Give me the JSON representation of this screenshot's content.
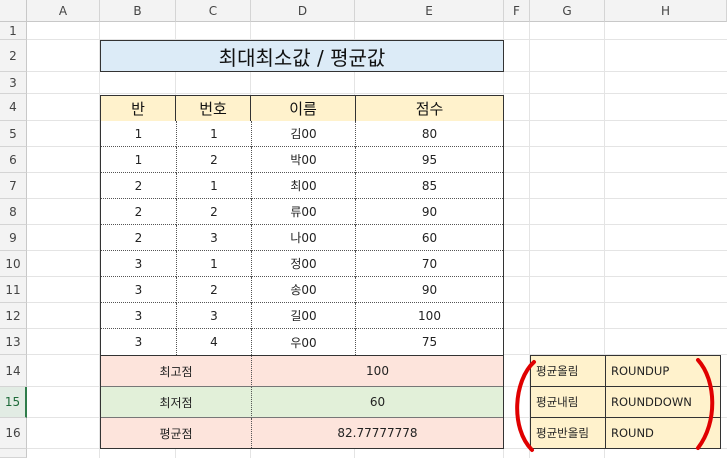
{
  "columns": [
    "A",
    "B",
    "C",
    "D",
    "E",
    "F",
    "G",
    "H"
  ],
  "rows": [
    "1",
    "2",
    "3",
    "4",
    "5",
    "6",
    "7",
    "8",
    "9",
    "10",
    "11",
    "12",
    "13",
    "14",
    "15",
    "16"
  ],
  "title": "최대최소값 / 평균값",
  "table": {
    "headers": [
      "반",
      "번호",
      "이름",
      "점수"
    ],
    "rows": [
      [
        "1",
        "1",
        "김00",
        "80"
      ],
      [
        "1",
        "2",
        "박00",
        "95"
      ],
      [
        "2",
        "1",
        "최00",
        "85"
      ],
      [
        "2",
        "2",
        "류00",
        "90"
      ],
      [
        "2",
        "3",
        "나00",
        "60"
      ],
      [
        "3",
        "1",
        "정00",
        "70"
      ],
      [
        "3",
        "2",
        "송00",
        "90"
      ],
      [
        "3",
        "3",
        "길00",
        "100"
      ],
      [
        "3",
        "4",
        "우00",
        "75"
      ]
    ]
  },
  "summary": [
    {
      "label": "최고점",
      "value": "100",
      "color": "#fde4dc"
    },
    {
      "label": "최저점",
      "value": "60",
      "color": "#e2f0d9"
    },
    {
      "label": "평균점",
      "value": "82.77777778",
      "color": "#fde4dc"
    }
  ],
  "functions": [
    {
      "label": "평균올림",
      "fn": "ROUNDUP"
    },
    {
      "label": "평균내림",
      "fn": "ROUNDDOWN"
    },
    {
      "label": "평균반올림",
      "fn": "ROUND"
    }
  ],
  "colors": {
    "title_bg": "#dcebf7",
    "header_bg": "#fff2cc",
    "paren": "#e00000",
    "selected_row": "#2e7d4a"
  },
  "selected_row": "15"
}
